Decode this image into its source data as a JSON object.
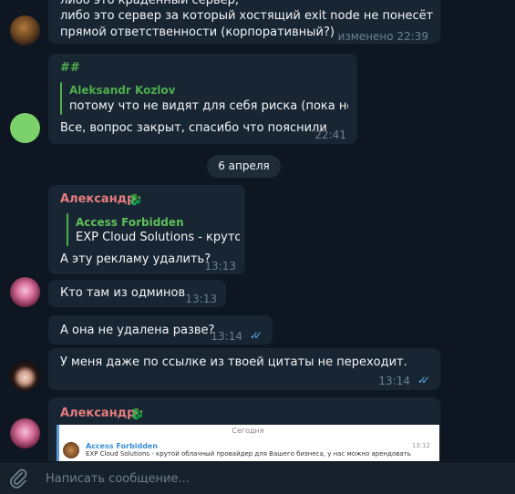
{
  "messages": {
    "m1": {
      "line0": "либо это краденный сервер,",
      "line1": "либо это сервер за который хостящий exit node не понесёт",
      "line2": "прямой ответственности (корпоративный?)",
      "time": "изменено 22:39"
    },
    "m2": {
      "title": "##",
      "reply_name": "Aleksandr Kozlov",
      "reply_text": "потому что не видят для себя риска (пока не к...",
      "text": "Все, вопрос закрыт, спасибо что пояснили",
      "time": "22:41"
    },
    "date_separator": "6 апреля",
    "m3": {
      "sender": "Александр",
      "reply_name": "Access Forbidden",
      "reply_text": "EXP Cloud Solutions - круто...",
      "text": "А эту рекламу удалить?",
      "time": "13:13"
    },
    "m4": {
      "text": "Кто там из одминов",
      "time": "13:13"
    },
    "m5": {
      "text": "А она не удалена разве?",
      "time": "13:14"
    },
    "m6": {
      "text": "У меня даже по ссылке из твоей цитаты не переходит.",
      "time": "13:14"
    },
    "m7": {
      "sender": "Александр",
      "preview_header": "Сегодня",
      "preview_name": "Access Forbidden",
      "preview_text": "EXP Cloud Solutions - крутой облачный провайдер для Вашего бизнеса, у нас можно арендовать",
      "preview_time": "13:12"
    }
  },
  "input": {
    "placeholder": "Написать сообщение..."
  },
  "icons": {
    "attach": "paperclip-icon",
    "read": "double-check-icon",
    "sender_badge": "dragon-icon"
  },
  "colors": {
    "background": "#0e1621",
    "bubble": "#182533",
    "sender_name": "#e67d7d",
    "reply_accent": "#4fae4e",
    "read_check": "#5ea9de",
    "timestamp": "#6d7f8f"
  }
}
